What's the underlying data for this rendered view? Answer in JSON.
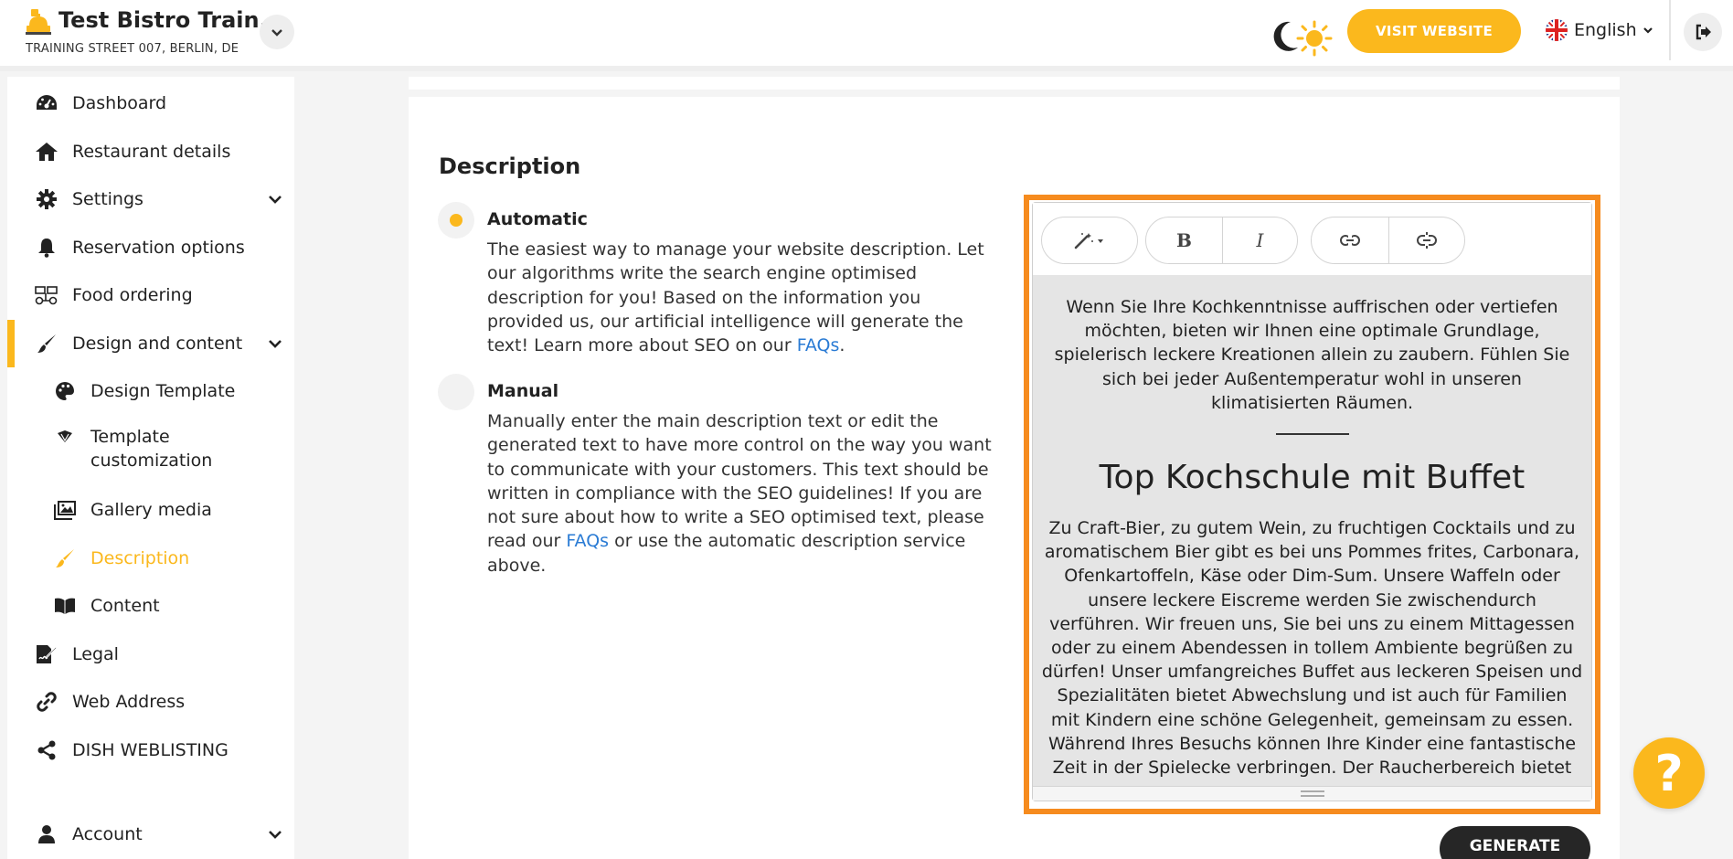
{
  "header": {
    "brand_name": "Test Bistro Train...",
    "brand_address": "TRAINING STREET 007, BERLIN, DE",
    "visit_website_label": "VISIT WEBSITE",
    "language_label": "English",
    "accent_color": "#fbb81d"
  },
  "sidebar": {
    "items": [
      {
        "label": "Dashboard",
        "icon": "dashboard-icon"
      },
      {
        "label": "Restaurant details",
        "icon": "home-icon"
      },
      {
        "label": "Settings",
        "icon": "gear-icon"
      },
      {
        "label": "Reservation options",
        "icon": "bell-icon"
      },
      {
        "label": "Food ordering",
        "icon": "food-ordering-icon"
      },
      {
        "label": "Design and content",
        "icon": "brush-icon"
      },
      {
        "label": "Design Template",
        "icon": "palette-icon"
      },
      {
        "label": "Template",
        "label2": "customization",
        "icon": "swatch-icon"
      },
      {
        "label": "Gallery media",
        "icon": "images-icon"
      },
      {
        "label": "Description",
        "icon": "pen-icon",
        "active": true
      },
      {
        "label": "Content",
        "icon": "book-icon"
      },
      {
        "label": "Legal",
        "icon": "signature-icon"
      },
      {
        "label": "Web Address",
        "icon": "link-icon"
      },
      {
        "label": "DISH WEBLISTING",
        "icon": "share-icon"
      },
      {
        "label": "Account",
        "icon": "user-icon"
      }
    ]
  },
  "main": {
    "section_title": "Description",
    "options": {
      "automatic": {
        "title": "Automatic",
        "text": "The easiest way to manage your website description. Let our algorithms write the search engine optimised description for you! Based on the information you provided us, our artificial intelligence will generate the text! Learn more about SEO on our ",
        "link": "FAQs",
        "text_end": ".",
        "selected": true
      },
      "manual": {
        "title": "Manual",
        "text": "Manually enter the main description text or edit the generated text to have more control on the way you want to communicate with your customers. This text should be written in compliance with the SEO guidelines! If you are not sure about how to write a SEO optimised text, please read our ",
        "link": "FAQs",
        "text_end": " or use the automatic description service above.",
        "selected": false
      }
    },
    "editor": {
      "toolbar": {
        "bold": "B",
        "italic": "I"
      },
      "intro": "Wenn Sie Ihre Kochkenntnisse auffrischen oder vertiefen möchten, bieten wir Ihnen eine optimale Grundlage, spielerisch leckere Kreationen allein zu zaubern. Fühlen Sie sich bei jeder Außentemperatur wohl in unseren klimatisierten Räumen.",
      "heading": "Top Kochschule mit Buffet",
      "body": "Zu Craft-Bier, zu gutem Wein, zu fruchtigen Cocktails und zu aromatischem Bier gibt es bei uns Pommes frites, Carbonara, Ofenkartoffeln, Käse oder Dim-Sum. Unsere Waffeln oder unsere leckere Eiscreme werden Sie zwischendurch verführen. Wir freuen uns, Sie bei uns zu einem Mittagessen oder zu einem Abendessen in tollem Ambiente begrüßen zu dürfen! Unser umfangreiches Buffet aus leckeren Speisen und Spezialitäten bietet Abwechslung und ist auch für Familien mit Kindern eine schöne Gelegenheit, gemeinsam zu essen. Während Ihres Besuchs können Ihre Kinder eine fantastische Zeit in der Spielecke verbringen. Der Raucherbereich bietet"
    },
    "generate_label": "GENERATE",
    "help_label": "?"
  }
}
